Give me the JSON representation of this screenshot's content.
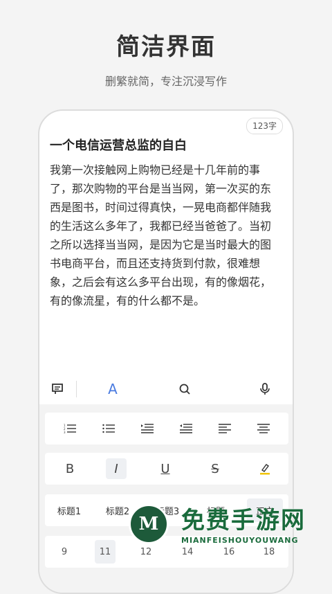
{
  "hero": {
    "title": "简洁界面",
    "subtitle": "删繁就简，专注沉浸写作"
  },
  "editor": {
    "word_count": "123字",
    "title": "一个电信运营总监的自白",
    "body": "我第一次接触网上购物已经是十几年前的事了，那次购物的平台是当当网，第一次买的东西是图书，时间过得真快，一晃电商都伴随我的生活这么多年了，我都已经当爸爸了。当初之所以选择当当网，是因为它是当时最大的图书电商平台，而且还支持货到付款，很难想象，之后会有这么多平台出现，有的像烟花，有的像流星，有的什么都不是。"
  },
  "toolbar": {
    "tabs": [
      {
        "icon": "comment-icon"
      },
      {
        "icon": "font-style-icon",
        "label": "A",
        "active": true
      },
      {
        "icon": "search-icon"
      },
      {
        "icon": "microphone-icon"
      }
    ],
    "accent_color": "#4a7be0",
    "format_row": [
      "B",
      "I",
      "U",
      "S"
    ],
    "headings": [
      "标题1",
      "标题2",
      "标题3",
      "标题",
      "正文"
    ],
    "font_sizes": [
      "9",
      "11",
      "12",
      "14",
      "16",
      "18"
    ]
  },
  "watermark": {
    "cn": "免费手游网",
    "en": "MIANFEISHOUYOUWANG",
    "logo": "M"
  }
}
